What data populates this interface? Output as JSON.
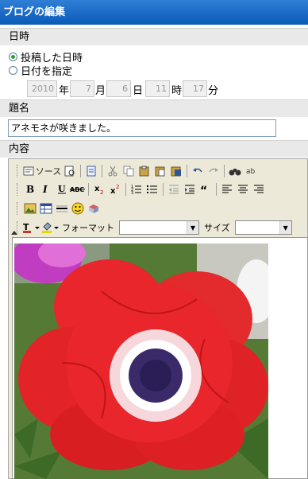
{
  "header": {
    "title": "ブログの編集"
  },
  "datetime": {
    "section_label": "日時",
    "option_posted": "投稿した日時",
    "option_specify": "日付を指定",
    "year": "2010",
    "year_unit": "年",
    "month": "7",
    "month_unit": "月",
    "day": "6",
    "day_unit": "日",
    "hour": "11",
    "hour_unit": "時",
    "minute": "17",
    "minute_unit": "分"
  },
  "title_section": {
    "label": "題名",
    "value": "アネモネが咲きました。"
  },
  "content_section": {
    "label": "内容"
  },
  "toolbar": {
    "source_label": "ソース",
    "format_label": "フォーマット",
    "size_label": "サイズ",
    "format_value": "",
    "size_value": ""
  },
  "colors": {
    "header": "#0a5ab8",
    "section_bg": "#e9e9e9",
    "flower_red": "#e8262b",
    "flower_center": "#3a2a6a"
  }
}
